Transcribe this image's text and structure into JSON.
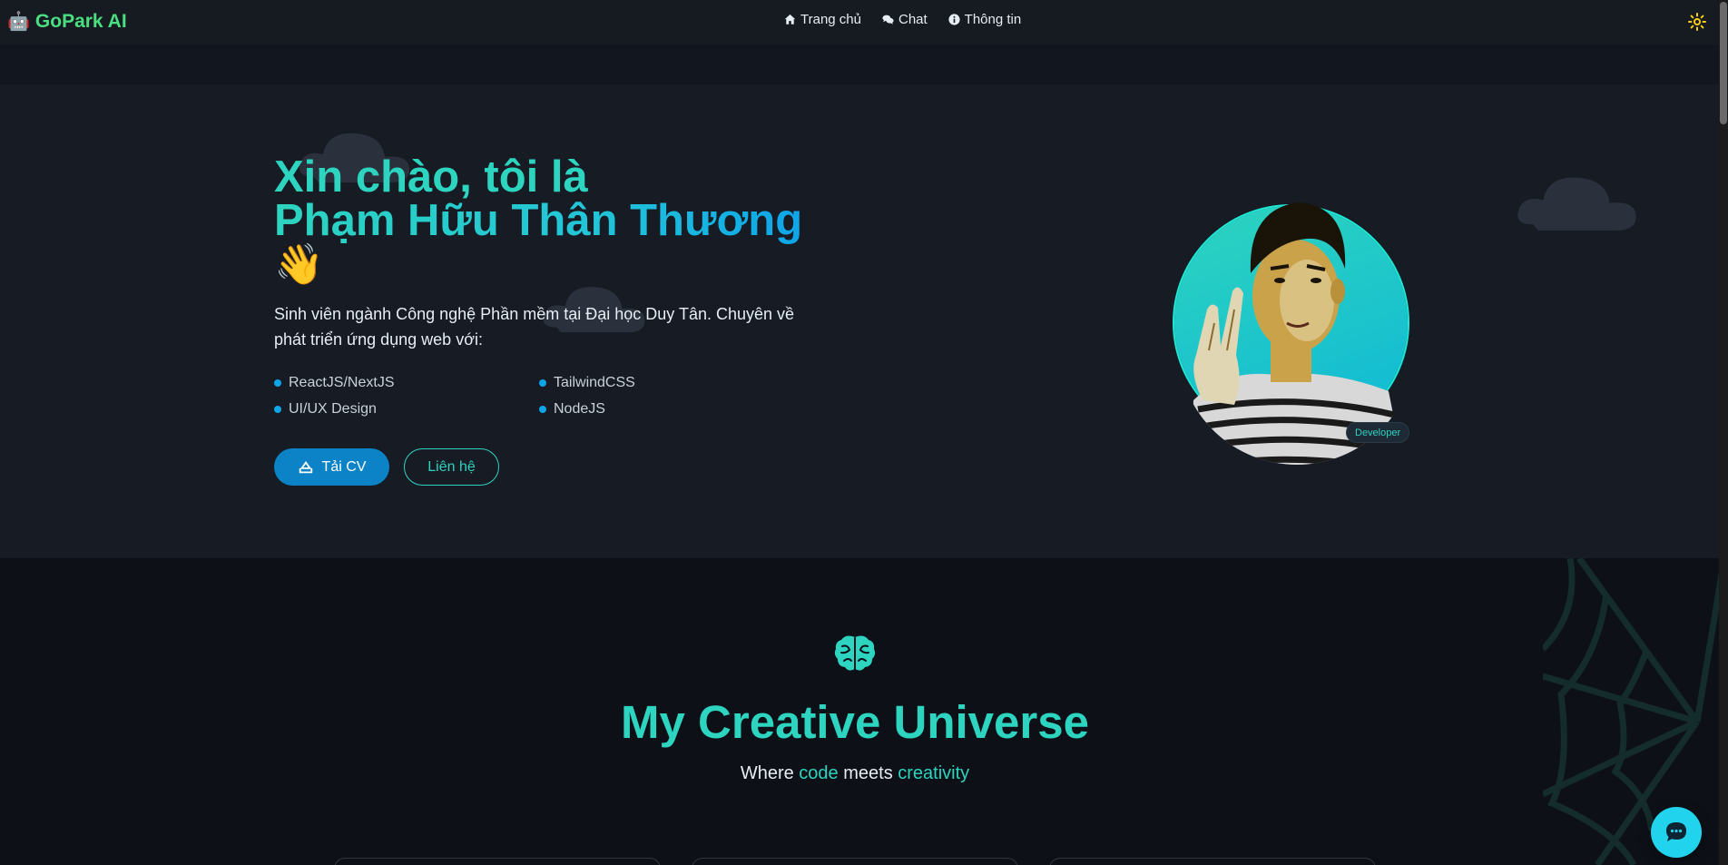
{
  "navbar": {
    "brand_icon": "🤖",
    "brand_name": "GoPark AI",
    "links": [
      {
        "label": "Trang chủ",
        "icon": "home-icon"
      },
      {
        "label": "Chat",
        "icon": "comments-icon"
      },
      {
        "label": "Thông tin",
        "icon": "info-circle-icon"
      }
    ],
    "theme_icon": "sun-icon"
  },
  "hero": {
    "title_line1": "Xin chào, tôi là",
    "title_line2": "Phạm Hữu Thân Thương",
    "wave": "👋",
    "description": "Sinh viên ngành Công nghệ Phần mềm tại Đại học Duy Tân. Chuyên về phát triển ứng dụng web với:",
    "skills": [
      "ReactJS/NextJS",
      "TailwindCSS",
      "UI/UX Design",
      "NodeJS"
    ],
    "cv_button": "Tải CV",
    "contact_button": "Liên hệ",
    "badge": "Developer"
  },
  "section2": {
    "title": "My Creative Universe",
    "subtitle_part1": "Where ",
    "subtitle_hl1": "code",
    "subtitle_part2": " meets ",
    "subtitle_hl2": "creativity"
  },
  "colors": {
    "accent": "#2dd4bf",
    "brand": "#4ade80",
    "primary_button": "#0b83c6",
    "background": "#0d1117",
    "hero_background": "#161b24"
  }
}
